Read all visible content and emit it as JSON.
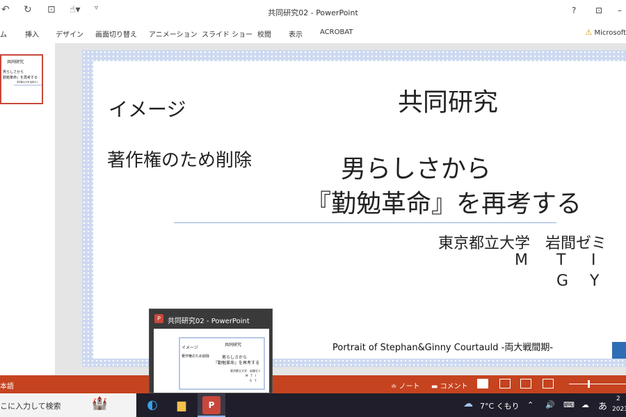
{
  "window": {
    "title": "共同研究02 - PowerPoint",
    "help_label": "?",
    "qat": [
      "undo-icon",
      "redo-icon",
      "present-icon",
      "touch-mode-icon",
      "customize-icon"
    ]
  },
  "ribbon": {
    "tabs": [
      "ム",
      "挿入",
      "デザイン",
      "画面切り替え",
      "アニメーション",
      "スライド ショー",
      "校閲",
      "表示",
      "ACROBAT"
    ],
    "account_label": "Microsoft"
  },
  "slide": {
    "left_heading": "イメージ",
    "left_note": "著作権のため削除",
    "title": "共同研究",
    "subtitle_line1": "男らしさから",
    "subtitle_line2": "『勤勉革命』を再考する",
    "university": "東京都立大学　岩間ゼミ",
    "members_row1": [
      "M",
      "T",
      "I"
    ],
    "members_row2": [
      "G",
      "Y"
    ],
    "caption": "Portrait of Stephan&Ginny Courtauld -両大戦間期-"
  },
  "thumbnail": {
    "title": "共同研究",
    "line1": "男らしさから",
    "line2": "勤勉革命』を再考する",
    "line3": "東京都立大学 岩間ゼミ"
  },
  "preview": {
    "title": "共同研究02 - PowerPoint",
    "icon_letter": "P",
    "left_heading": "イメージ",
    "left_note": "著作権のため削除",
    "slide_title": "共同研究",
    "sub1": "男らしさから",
    "sub2": "『勤勉革命』を再考する",
    "uni": "東京都立大学　岩間ゼミ",
    "mem1": "M　T　I",
    "mem2": "G　Y"
  },
  "statusbar": {
    "language": "本語",
    "notes_label": "ノート",
    "comments_label": "コメント"
  },
  "taskbar": {
    "search_text": "こに入力して検索",
    "weather": "7°C くもり",
    "ime": "あ",
    "clock_top": "2",
    "clock_bottom": "2023"
  },
  "colors": {
    "accent": "#c5431f",
    "taskbar": "#1f1e2a",
    "slide_border": "#cdd9f0"
  }
}
